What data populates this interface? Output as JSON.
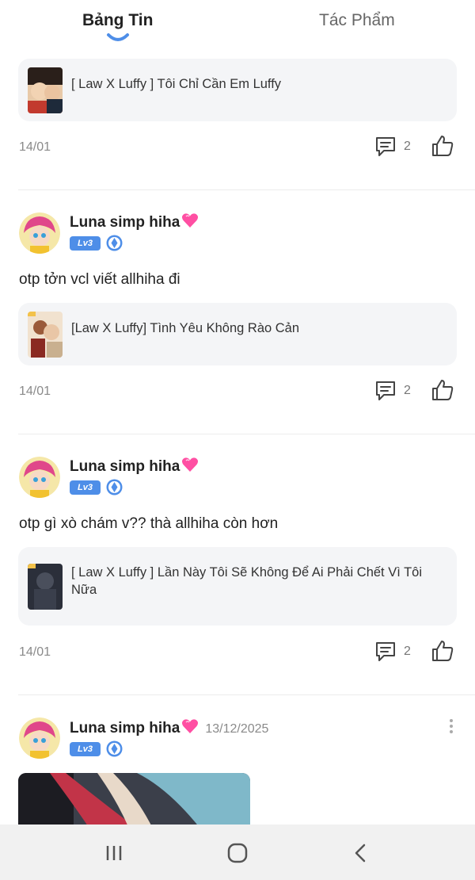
{
  "tabs": [
    {
      "label": "Bảng Tin",
      "active": true
    },
    {
      "label": "Tác Phẩm",
      "active": false
    }
  ],
  "feed": {
    "top_work": {
      "title": "[ Law X Luffy ] Tôi Chỉ Cần Em Luffy",
      "date": "14/01",
      "comments": "2"
    },
    "posts": [
      {
        "user": "Luna simp hiha",
        "level": "Lv3",
        "text": "otp tởn vcl viết allhiha đi",
        "work_title": "[Law X Luffy] Tình Yêu Không Rào Cản",
        "date": "14/01",
        "comments": "2"
      },
      {
        "user": "Luna simp hiha",
        "level": "Lv3",
        "text": "otp gì xò chám v?? thà allhiha còn hơn",
        "work_title": "[ Law X Luffy ] Lần Này Tôi Sẽ Không Để Ai Phải Chết Vì Tôi Nữa",
        "date": "14/01",
        "comments": "2"
      },
      {
        "user": "Luna simp hiha",
        "level": "Lv3",
        "timestamp": "13/12/2025"
      }
    ]
  },
  "icons": {
    "heart": "heart-emoji-icon",
    "comment": "comment-icon",
    "like": "thumbs-up-icon",
    "gem": "gem-icon",
    "more": "more-vertical-icon"
  },
  "colors": {
    "accent": "#4e8ee8",
    "card_bg": "#f4f5f7",
    "heart": "#ff4fa3"
  }
}
